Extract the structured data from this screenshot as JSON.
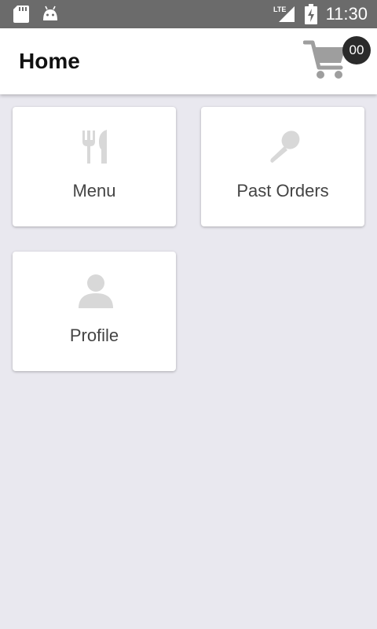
{
  "status_bar": {
    "time": "11:30",
    "network": "LTE",
    "icons": [
      "sd-card-icon",
      "android-icon",
      "signal-icon",
      "battery-charging-icon"
    ]
  },
  "app_bar": {
    "title": "Home",
    "cart_badge": "00",
    "cart_icon": "shopping-cart-icon"
  },
  "tiles": [
    {
      "label": "Menu",
      "icon": "fork-knife-icon"
    },
    {
      "label": "Past Orders",
      "icon": "spoon-icon"
    },
    {
      "label": "Profile",
      "icon": "person-icon"
    }
  ],
  "colors": {
    "status_bar": "#6b6b6b",
    "app_bar": "#ffffff",
    "background": "#e9e8ef",
    "tile_icon": "#d8d8d8",
    "cart_icon": "#9e9e9e",
    "badge": "#2b2b2b"
  }
}
